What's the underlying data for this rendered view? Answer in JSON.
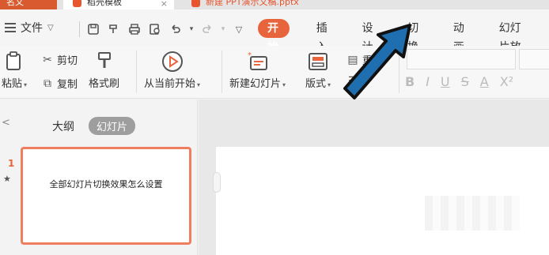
{
  "tabs": {
    "first": "名文",
    "second": "稻壳模板",
    "third": "新建 PPT演示文稿.pptx"
  },
  "menu": {
    "file_label": "文件",
    "ribbon_tabs": [
      {
        "label": "开始",
        "active": true
      },
      {
        "label": "插入",
        "active": false
      },
      {
        "label": "设计",
        "active": false
      },
      {
        "label": "切换",
        "active": false
      },
      {
        "label": "动画",
        "active": false
      },
      {
        "label": "幻灯片放",
        "active": false
      }
    ]
  },
  "quick_access": {
    "icons": [
      "save-icon",
      "format-painter-quick-icon",
      "print-icon",
      "print-preview-icon",
      "undo-icon",
      "redo-icon",
      "customize-dropdown-icon"
    ]
  },
  "toolbar": {
    "paste_label": "粘贴",
    "cut_label": "剪切",
    "copy_label": "复制",
    "format_painter_label": "格式刷",
    "play_from_current_label": "从当前开始",
    "new_slide_label": "新建幻灯片",
    "layout_label": "版式",
    "reset_label": "重"
  },
  "formatting": {
    "bold": "B",
    "italic": "I",
    "underline": "U",
    "strikethrough": "S",
    "font_color": "A",
    "superscript": "X²"
  },
  "panel": {
    "outline_tab": "大纲",
    "slides_tab": "幻灯片",
    "slide_number": "1",
    "slide_star": "★",
    "slide_title": "全部幻灯片切换效果怎么设置"
  },
  "colors": {
    "accent": "#e8643c",
    "arrow": "#1f6fb0"
  }
}
